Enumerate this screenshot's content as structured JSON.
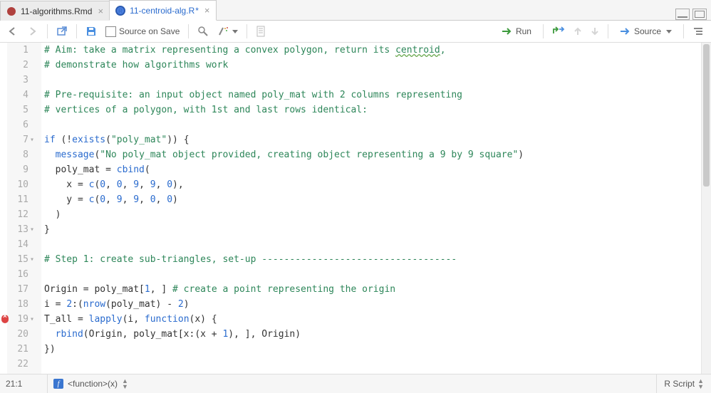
{
  "tabs": [
    {
      "label": "11-algorithms.Rmd",
      "icon": "rmd",
      "active": false,
      "dirty": false
    },
    {
      "label": "11-centroid-alg.R",
      "icon": "r",
      "active": true,
      "dirty": true
    }
  ],
  "toolbar": {
    "source_on_save_label": "Source on Save",
    "run_label": "Run",
    "source_label": "Source"
  },
  "gutter": {
    "lines": [
      "1",
      "2",
      "3",
      "4",
      "5",
      "6",
      "7",
      "8",
      "9",
      "10",
      "11",
      "12",
      "13",
      "14",
      "15",
      "16",
      "17",
      "18",
      "19",
      "20",
      "21",
      "22"
    ],
    "fold_markers": {
      "7": true,
      "13": true,
      "15": true,
      "19": true
    },
    "error_markers": {
      "19": true
    }
  },
  "code_lines": [
    {
      "n": 1,
      "segments": [
        {
          "t": "# Aim: take a matrix representing a convex polygon, return its ",
          "c": "c-comment"
        },
        {
          "t": "centroid",
          "c": "c-comment underline-wavy"
        },
        {
          "t": ",",
          "c": "c-comment"
        }
      ]
    },
    {
      "n": 2,
      "segments": [
        {
          "t": "# demonstrate how algorithms work",
          "c": "c-comment"
        }
      ]
    },
    {
      "n": 3,
      "segments": []
    },
    {
      "n": 4,
      "segments": [
        {
          "t": "# Pre-requisite: an input object named poly_mat with 2 columns representing",
          "c": "c-comment"
        }
      ]
    },
    {
      "n": 5,
      "segments": [
        {
          "t": "# vertices of a polygon, with 1st and last rows identical:",
          "c": "c-comment"
        }
      ]
    },
    {
      "n": 6,
      "segments": []
    },
    {
      "n": 7,
      "segments": [
        {
          "t": "if",
          "c": "c-kw"
        },
        {
          "t": " (!",
          "c": ""
        },
        {
          "t": "exists",
          "c": "c-kw"
        },
        {
          "t": "(",
          "c": ""
        },
        {
          "t": "\"poly_mat\"",
          "c": "c-str"
        },
        {
          "t": ")) {",
          "c": ""
        }
      ]
    },
    {
      "n": 8,
      "segments": [
        {
          "t": "  ",
          "c": ""
        },
        {
          "t": "message",
          "c": "c-kw"
        },
        {
          "t": "(",
          "c": ""
        },
        {
          "t": "\"No poly_mat object provided, creating object representing a 9 by 9 square\"",
          "c": "c-str"
        },
        {
          "t": ")",
          "c": ""
        }
      ]
    },
    {
      "n": 9,
      "segments": [
        {
          "t": "  poly_mat = ",
          "c": ""
        },
        {
          "t": "cbind",
          "c": "c-kw"
        },
        {
          "t": "(",
          "c": ""
        }
      ]
    },
    {
      "n": 10,
      "segments": [
        {
          "t": "    x = ",
          "c": ""
        },
        {
          "t": "c",
          "c": "c-kw"
        },
        {
          "t": "(",
          "c": ""
        },
        {
          "t": "0",
          "c": "c-num"
        },
        {
          "t": ", ",
          "c": ""
        },
        {
          "t": "0",
          "c": "c-num"
        },
        {
          "t": ", ",
          "c": ""
        },
        {
          "t": "9",
          "c": "c-num"
        },
        {
          "t": ", ",
          "c": ""
        },
        {
          "t": "9",
          "c": "c-num"
        },
        {
          "t": ", ",
          "c": ""
        },
        {
          "t": "0",
          "c": "c-num"
        },
        {
          "t": "),",
          "c": ""
        }
      ]
    },
    {
      "n": 11,
      "segments": [
        {
          "t": "    y = ",
          "c": ""
        },
        {
          "t": "c",
          "c": "c-kw"
        },
        {
          "t": "(",
          "c": ""
        },
        {
          "t": "0",
          "c": "c-num"
        },
        {
          "t": ", ",
          "c": ""
        },
        {
          "t": "9",
          "c": "c-num"
        },
        {
          "t": ", ",
          "c": ""
        },
        {
          "t": "9",
          "c": "c-num"
        },
        {
          "t": ", ",
          "c": ""
        },
        {
          "t": "0",
          "c": "c-num"
        },
        {
          "t": ", ",
          "c": ""
        },
        {
          "t": "0",
          "c": "c-num"
        },
        {
          "t": ")",
          "c": ""
        }
      ]
    },
    {
      "n": 12,
      "segments": [
        {
          "t": "  )",
          "c": ""
        }
      ]
    },
    {
      "n": 13,
      "segments": [
        {
          "t": "}",
          "c": ""
        }
      ]
    },
    {
      "n": 14,
      "segments": []
    },
    {
      "n": 15,
      "segments": [
        {
          "t": "# Step 1: create sub-triangles, set-up -----------------------------------",
          "c": "c-comment"
        }
      ]
    },
    {
      "n": 16,
      "segments": []
    },
    {
      "n": 17,
      "segments": [
        {
          "t": "Origin = poly_mat[",
          "c": ""
        },
        {
          "t": "1",
          "c": "c-num"
        },
        {
          "t": ", ] ",
          "c": ""
        },
        {
          "t": "# create a point representing the origin",
          "c": "c-comment"
        }
      ]
    },
    {
      "n": 18,
      "segments": [
        {
          "t": "i = ",
          "c": ""
        },
        {
          "t": "2",
          "c": "c-num"
        },
        {
          "t": ":(",
          "c": ""
        },
        {
          "t": "nrow",
          "c": "c-kw"
        },
        {
          "t": "(poly_mat) - ",
          "c": ""
        },
        {
          "t": "2",
          "c": "c-num"
        },
        {
          "t": ")",
          "c": ""
        }
      ]
    },
    {
      "n": 19,
      "segments": [
        {
          "t": "T_all = ",
          "c": ""
        },
        {
          "t": "lapply",
          "c": "c-kw"
        },
        {
          "t": "(i, ",
          "c": ""
        },
        {
          "t": "function",
          "c": "c-kw"
        },
        {
          "t": "(x) {",
          "c": ""
        }
      ]
    },
    {
      "n": 20,
      "segments": [
        {
          "t": "  ",
          "c": ""
        },
        {
          "t": "rbind",
          "c": "c-kw"
        },
        {
          "t": "(Origin, poly_mat[x:(x + ",
          "c": ""
        },
        {
          "t": "1",
          "c": "c-num"
        },
        {
          "t": "), ], Origin)",
          "c": ""
        }
      ]
    },
    {
      "n": 21,
      "segments": [
        {
          "t": "})",
          "c": ""
        }
      ]
    },
    {
      "n": 22,
      "segments": []
    }
  ],
  "status": {
    "cursor": "21:1",
    "scope": "<function>(x)",
    "language": "R Script"
  },
  "colors": {
    "keyword": "#2a6bce",
    "comment": "#2d8659",
    "string": "#2d8659",
    "number": "#2a6bce"
  }
}
